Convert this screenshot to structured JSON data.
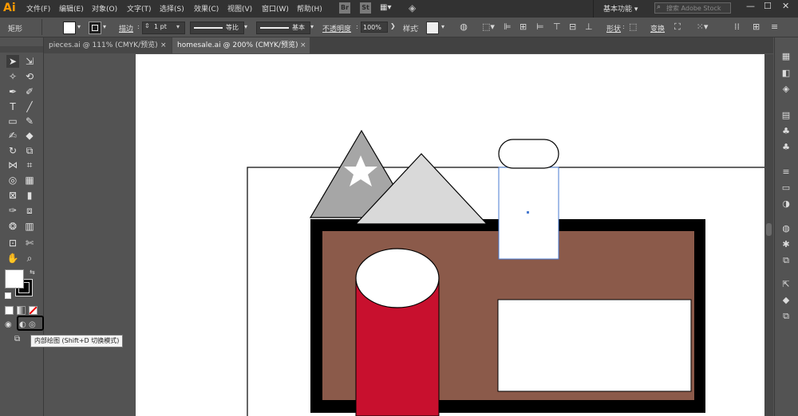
{
  "app": {
    "logo": "Ai",
    "menus": [
      "文件(F)",
      "编辑(E)",
      "对象(O)",
      "文字(T)",
      "选择(S)",
      "效果(C)",
      "视图(V)",
      "窗口(W)",
      "帮助(H)"
    ],
    "bridge_label": "Br",
    "stock_label": "St",
    "workspace": "基本功能",
    "search_placeholder": "搜索 Adobe Stock"
  },
  "control_bar": {
    "object_type": "矩形",
    "stroke_label": "描边",
    "stroke_weight": "1 pt",
    "profile_label": "等比",
    "brush_label": "基本",
    "opacity_label": "不透明度",
    "opacity_value": "100%",
    "style_label": "样式",
    "shape_label": "形状",
    "transform_label": "变换"
  },
  "tabs": [
    {
      "label": "pieces.ai @ 111% (CMYK/预览)"
    },
    {
      "label": "homesale.ai @ 200% (CMYK/预览)"
    }
  ],
  "tooltip": "内部绘图 (Shift+D 切换模式)",
  "colors": {
    "fill": "#ffffff",
    "stroke": "#000000",
    "brown": "#8b5a4a",
    "red": "#c8102e",
    "gray_triangle": "#a6a6a6",
    "light_triangle": "#d9d9d9",
    "selection_blue": "#4a7bd0"
  },
  "icons": {
    "close": "×",
    "dropdown": "▾"
  }
}
